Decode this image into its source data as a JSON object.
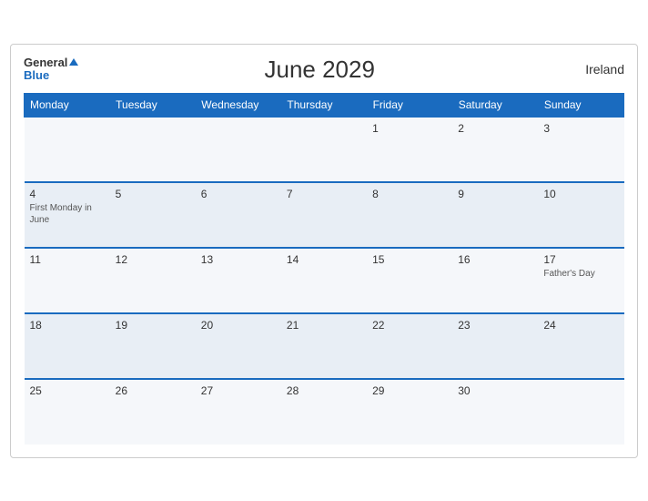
{
  "header": {
    "logo_general": "General",
    "logo_blue": "Blue",
    "title": "June 2029",
    "country": "Ireland"
  },
  "weekdays": [
    "Monday",
    "Tuesday",
    "Wednesday",
    "Thursday",
    "Friday",
    "Saturday",
    "Sunday"
  ],
  "weeks": [
    [
      {
        "day": "",
        "event": ""
      },
      {
        "day": "",
        "event": ""
      },
      {
        "day": "",
        "event": ""
      },
      {
        "day": "",
        "event": ""
      },
      {
        "day": "1",
        "event": ""
      },
      {
        "day": "2",
        "event": ""
      },
      {
        "day": "3",
        "event": ""
      }
    ],
    [
      {
        "day": "4",
        "event": "First Monday in June"
      },
      {
        "day": "5",
        "event": ""
      },
      {
        "day": "6",
        "event": ""
      },
      {
        "day": "7",
        "event": ""
      },
      {
        "day": "8",
        "event": ""
      },
      {
        "day": "9",
        "event": ""
      },
      {
        "day": "10",
        "event": ""
      }
    ],
    [
      {
        "day": "11",
        "event": ""
      },
      {
        "day": "12",
        "event": ""
      },
      {
        "day": "13",
        "event": ""
      },
      {
        "day": "14",
        "event": ""
      },
      {
        "day": "15",
        "event": ""
      },
      {
        "day": "16",
        "event": ""
      },
      {
        "day": "17",
        "event": "Father's Day"
      }
    ],
    [
      {
        "day": "18",
        "event": ""
      },
      {
        "day": "19",
        "event": ""
      },
      {
        "day": "20",
        "event": ""
      },
      {
        "day": "21",
        "event": ""
      },
      {
        "day": "22",
        "event": ""
      },
      {
        "day": "23",
        "event": ""
      },
      {
        "day": "24",
        "event": ""
      }
    ],
    [
      {
        "day": "25",
        "event": ""
      },
      {
        "day": "26",
        "event": ""
      },
      {
        "day": "27",
        "event": ""
      },
      {
        "day": "28",
        "event": ""
      },
      {
        "day": "29",
        "event": ""
      },
      {
        "day": "30",
        "event": ""
      },
      {
        "day": "",
        "event": ""
      }
    ]
  ]
}
